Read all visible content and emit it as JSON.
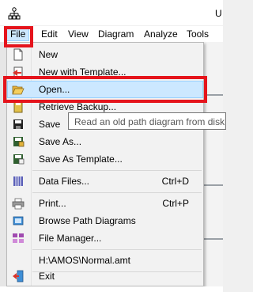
{
  "window": {
    "title_partial": "U"
  },
  "menubar": {
    "items": [
      {
        "label": "File"
      },
      {
        "label": "Edit"
      },
      {
        "label": "View"
      },
      {
        "label": "Diagram"
      },
      {
        "label": "Analyze"
      },
      {
        "label": "Tools"
      }
    ]
  },
  "file_menu": {
    "new": {
      "label": "New",
      "icon": "blank-page-icon"
    },
    "new_template": {
      "label": "New with Template...",
      "icon": "new-template-icon"
    },
    "open": {
      "label": "Open...",
      "icon": "open-folder-icon"
    },
    "retrieve_backup": {
      "label": "Retrieve Backup...",
      "icon": "backup-icon"
    },
    "save": {
      "label": "Save",
      "icon": "floppy-disk-icon"
    },
    "save_as": {
      "label": "Save As...",
      "icon": "save-as-icon"
    },
    "save_as_template": {
      "label": "Save As  Template...",
      "icon": "save-template-icon"
    },
    "data_files": {
      "label": "Data Files...",
      "shortcut": "Ctrl+D",
      "icon": "data-grid-icon"
    },
    "print": {
      "label": "Print...",
      "shortcut": "Ctrl+P",
      "icon": "printer-icon"
    },
    "browse": {
      "label": "Browse Path Diagrams",
      "icon": "browse-icon"
    },
    "file_manager": {
      "label": "File Manager...",
      "icon": "file-manager-icon"
    },
    "recent": {
      "label": "H:\\AMOS\\Normal.amt"
    },
    "exit": {
      "label": "Exit",
      "icon": "exit-door-icon"
    }
  },
  "tooltip": {
    "text": "Read an old path diagram from disk"
  },
  "colors": {
    "highlight_fill": "#cce8ff",
    "highlight_border": "#99d1ff",
    "annotation_red": "#e5141c"
  }
}
